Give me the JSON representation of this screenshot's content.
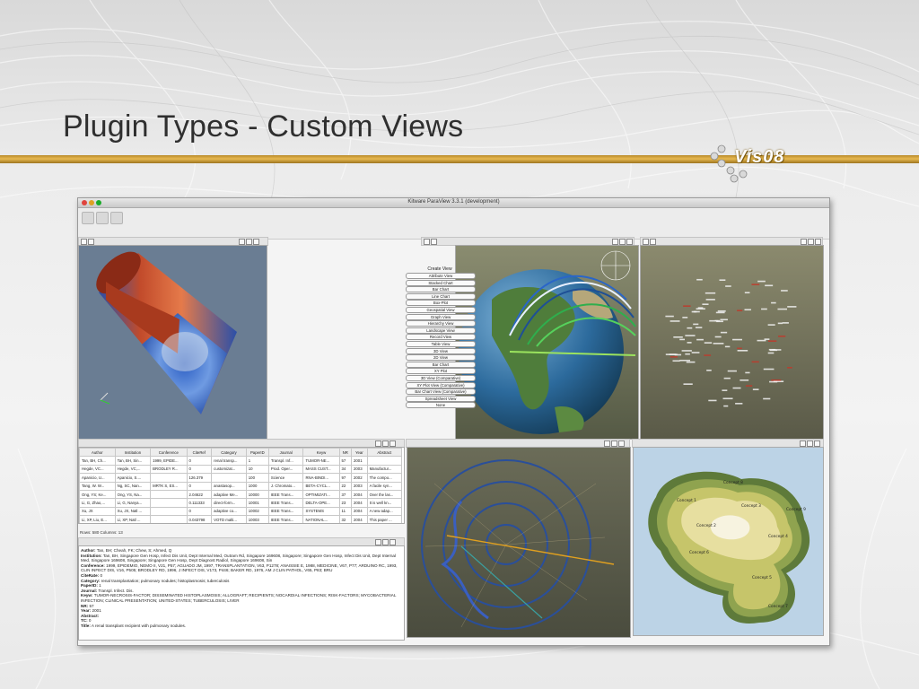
{
  "slide": {
    "title": "Plugin Types - Custom Views",
    "logo_text": "Vis08",
    "accent_color": "#e0b24a"
  },
  "window": {
    "title": "Kitware ParaView 3.3.1 (development)"
  },
  "custom_view_menu": {
    "title": "Create View",
    "options": [
      "Attribute View",
      "Stacked Chart",
      "Bar Chart",
      "Line Chart",
      "Box-Plot",
      "Geospatial View",
      "Graph View",
      "Hierarchy View",
      "Landscape View",
      "Record View",
      "Table View",
      "3D View",
      "2D View",
      "Bar Chart",
      "XY Plot",
      "3D View (Comparative)",
      "XY Plot View (Comparative)",
      "Bar Chart View (Comparative)",
      "Spreadsheet View",
      "None"
    ]
  },
  "spreadsheet": {
    "columns": [
      "Author",
      "Institution",
      "Conference",
      "CiteRef",
      "Category",
      "PaperID",
      "Journal",
      "Keyw",
      "NR",
      "Year",
      "Abstract"
    ],
    "rows": [
      [
        "Tan, BH, Ch...",
        "Tan, BH, Sin...",
        "1999, EPIDE...",
        "0",
        "renal transp...",
        "1",
        "Transpl. Inf...",
        "TUMOR-NE...",
        "57",
        "2001",
        ""
      ],
      [
        "Hegde, VC...",
        "Hegde, VC,...",
        "BRODLEY R...",
        "0",
        "customizat...",
        "10",
        "Prod. Oper...",
        "MASS CUST...",
        "34",
        "2003",
        "Manufactur..."
      ],
      [
        "Apanicio, U...",
        "Apanicio, S....",
        "",
        "126.379",
        "",
        "100",
        "Science",
        "RNA-BINDI...",
        "97",
        "2002",
        "The compo..."
      ],
      [
        "Tang, W. W...",
        "Ng, SC, Nan...",
        "MRTK S, ES...",
        "0",
        "anastasop...",
        "1000",
        "J. Chromato...",
        "BETA-CYCL...",
        "22",
        "2003",
        "A facile syn..."
      ],
      [
        "Ong, YS; Ke...",
        "Ong, YS, Na...",
        "",
        "2.04622",
        "adaptive Me...",
        "10000",
        "IEEE Trans...",
        "OPTIMIZATI...",
        "37",
        "2004",
        "Over the las..."
      ],
      [
        "Li, G, Zhao,...",
        "Li, G, Nanya...",
        "",
        "0.111333",
        "direct-form...",
        "10001",
        "IEEE Trans...",
        "DELTA-OPE...",
        "23",
        "2004",
        "It is well kn..."
      ],
      [
        "Xu, JX",
        "Xu, JX, Natl ...",
        "",
        "0",
        "adaptive co...",
        "10002",
        "IEEE Trans...",
        "SYSTEMS",
        "11",
        "2004",
        "A new adap..."
      ],
      [
        "Li, XP, Liu, E...",
        "Li, XP, Natl ...",
        "",
        "0.043798",
        "VOTD malti...",
        "10003",
        "IEEE Trans...",
        "NATIONAL...",
        "32",
        "2004",
        "This paper ..."
      ]
    ],
    "status": "Rows: 580  Columns: 13"
  },
  "record_view": {
    "fields": [
      {
        "k": "Author:",
        "v": "Tan, BH; Cheah, FK; Chew, S; Ahmed, Q"
      },
      {
        "k": "Institution:",
        "v": "Tan, BH, Singapore Gen Hosp, Infect Dis Unit, Dept Internal Med, Outram Rd, Singapore 169608, Singapore; Singapore Gen Hosp, Infect Dis Unit, Dept Internal Med, Singapore 169608, Singapore; Singapore Gen Hosp, Dept Diagnost Radiol, Singapore 169608, Sin"
      },
      {
        "k": "Conference:",
        "v": "1999, EPIDEMIO, NEMO II, V21, P57; AGUADO JM, 1997, TRANSPLANTATION, V63, P1278; ANAISSIE E, 1988, MEDICINE, V67, P77; ARDUINO RC, 1993, CLIN INFECT DIS, V16, P505; BRODLEY RD, 1996, J INFECT DIS, V173, P446; BAKER RD, 1976, AM J CLIN PATHOL, V65, P83; BRU"
      },
      {
        "k": "CiteRate:",
        "v": "0"
      },
      {
        "k": "Category:",
        "v": "renal transplantation; pulmonary nodules; histoplasmosis; tuberculosis"
      },
      {
        "k": "PaperID:",
        "v": "1"
      },
      {
        "k": "Journal:",
        "v": "Transpl. Infect. Dis."
      },
      {
        "k": "Keyw:",
        "v": "TUMOR-NECROSIS-FACTOR; DISSEMINATED HISTOPLASMOSIS; ALLOGRAFT; RECIPIENTS; NOCARDIAL INFECTIONS; RISK-FACTORS; MYCOBACTERIAL INFECTION; CLINICAL PRESENTATION; UNITED-STATES; TUBERCULOSIS; LIVER"
      },
      {
        "k": "NR:",
        "v": "57"
      },
      {
        "k": "Year:",
        "v": "2001"
      },
      {
        "k": "Abstract:",
        "v": ""
      },
      {
        "k": "TC:",
        "v": "0"
      },
      {
        "k": "Title:",
        "v": "A renal transplant recipient with pulmonary nodules."
      }
    ]
  },
  "landscape": {
    "labels": [
      "Concept 1",
      "Concept 2",
      "Concept 3",
      "Concept 4",
      "Concept 5",
      "Concept 6",
      "Concept 7",
      "Concept 8",
      "Concept 9"
    ]
  }
}
